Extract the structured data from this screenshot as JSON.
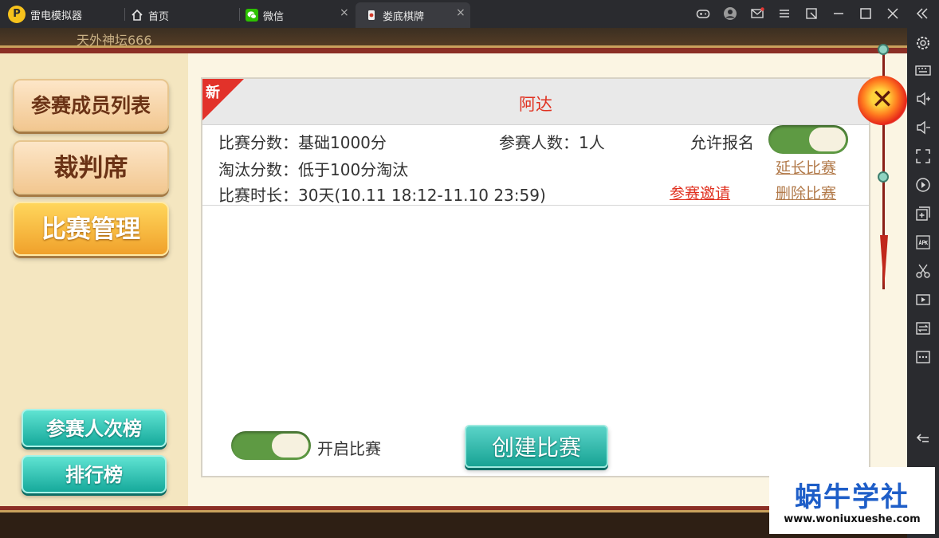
{
  "titlebar": {
    "app_name": "雷电模拟器",
    "tabs": [
      {
        "label": "首页",
        "icon": "home-icon"
      },
      {
        "label": "微信",
        "icon": "wechat-icon"
      },
      {
        "label": "娄底棋牌",
        "icon": "mahjong-icon",
        "active": true
      }
    ],
    "close_glyph": "×"
  },
  "game": {
    "player_name": "天外神坛666",
    "new_badge": "新",
    "match_title": "阿达",
    "left_menu": [
      {
        "label": "参赛成员列表"
      },
      {
        "label": "裁判席"
      },
      {
        "label": "比赛管理",
        "active": true
      }
    ],
    "bottom_buttons": [
      {
        "label": "参赛人次榜"
      },
      {
        "label": "排行榜"
      }
    ],
    "info": {
      "score_label": "比赛分数：",
      "score_value": "基础1000分",
      "players_label": "参赛人数：",
      "players_value": "1人",
      "allow_signup": "允许报名",
      "elim_label": "淘汰分数：",
      "elim_value": "低于100分淘汰",
      "duration_label": "比赛时长：",
      "duration_value": "30天(10.11 18:12-11.10 23:59)",
      "invite_link": "参赛邀请",
      "extend_link": "延长比赛",
      "delete_link": "删除比赛"
    },
    "open_match_label": "开启比赛",
    "create_button": "创建比赛",
    "toggles": {
      "allow_signup_on": true,
      "open_match_on": true
    }
  },
  "watermark": {
    "title": "蜗牛学社",
    "url": "www.woniuxueshe.com"
  },
  "colors": {
    "accent_red": "#e0301f",
    "teal_button": "#18a394",
    "toggle_green": "#5e9a43",
    "active_menu": "#f0a12b"
  }
}
